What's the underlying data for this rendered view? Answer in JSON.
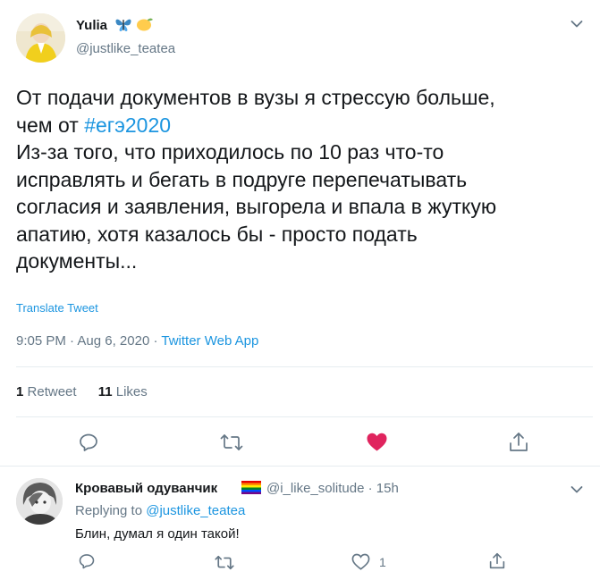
{
  "tweet": {
    "author_name": "Yulia",
    "author_handle": "@justlike_teatea",
    "text_lines": [
      "От подачи документов в вузы я стрессую больше,",
      "чем от ",
      "Из-за того, что приходилось по 10 раз что-то",
      "исправлять и бегать в подруге перепечатывать",
      "согласия и заявления, выгорела и впала в жуткую",
      "апатию, хотя казалось бы - просто подать",
      "документы..."
    ],
    "hashtag": "#егэ2020",
    "translate_label": "Translate Tweet",
    "time": "9:05 PM",
    "separator": "·",
    "date": "Aug 6, 2020",
    "source": "Twitter Web App",
    "retweets_count": "1",
    "retweets_label": "Retweet",
    "likes_count": "11",
    "likes_label": "Likes",
    "liked": true
  },
  "reply": {
    "author_name": "Кровавый одуванчик",
    "author_handle": "@i_like_solitude",
    "separator": "·",
    "time_ago": "15h",
    "replying_prefix": "Replying to ",
    "replying_to": "@justlike_teatea",
    "text": "Блин, думал я один такой!",
    "like_count": "1"
  },
  "icons": {
    "reply": "reply-icon",
    "retweet": "retweet-icon",
    "like": "heart-icon",
    "share": "share-icon",
    "more": "chevron-down-icon"
  },
  "colors": {
    "accent": "#1b95e0",
    "like_red": "#e0245e",
    "muted_text": "#657786",
    "border": "#e6ecf0"
  }
}
